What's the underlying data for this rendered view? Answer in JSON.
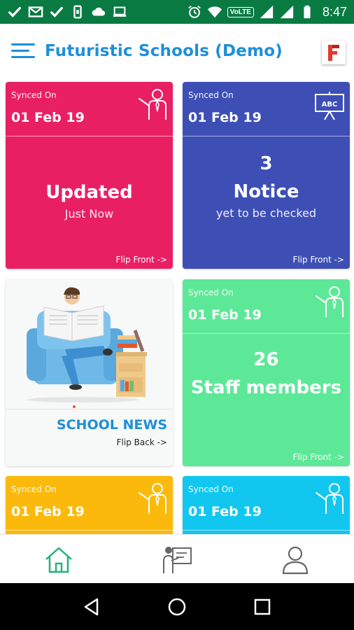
{
  "status_bar": {
    "time": "8:47",
    "network_label": "VoLTE"
  },
  "header": {
    "title": "Futuristic Schools (Demo)",
    "logo_letter": "F"
  },
  "cards": {
    "updates": {
      "synced_label": "Synced On",
      "synced_date": "01 Feb 19",
      "title": "Updated",
      "subtitle": "Just Now",
      "flip_label": "Flip Front ->",
      "color": "#e91f63"
    },
    "notice": {
      "synced_label": "Synced On",
      "synced_date": "01 Feb 19",
      "count": "3",
      "title": "Notice",
      "subtitle": "yet to be checked",
      "flip_label": "Flip Front ->",
      "color": "#3d4fb5"
    },
    "news": {
      "title": "SCHOOL NEWS",
      "flip_label": "Flip Back ->"
    },
    "staff": {
      "synced_label": "Synced On",
      "synced_date": "01 Feb 19",
      "count": "26",
      "title": "Staff members",
      "flip_label": "Flip Front ->",
      "color": "#5de898"
    },
    "yellow": {
      "synced_label": "Synced On",
      "synced_date": "01 Feb 19",
      "color": "#fbb90b"
    },
    "cyan": {
      "synced_label": "Synced On",
      "synced_date": "01 Feb 19",
      "color": "#11c7ef"
    }
  },
  "bottom_nav": [
    {
      "name": "home",
      "icon": "home-icon",
      "active": true
    },
    {
      "name": "classroom",
      "icon": "teacher-board-icon",
      "active": false
    },
    {
      "name": "profile",
      "icon": "user-icon",
      "active": false
    }
  ],
  "colors": {
    "status_bar": "#0a7a43",
    "accent": "#1d8fd9",
    "nav_active": "#27b07a",
    "nav_inactive": "#666666"
  }
}
